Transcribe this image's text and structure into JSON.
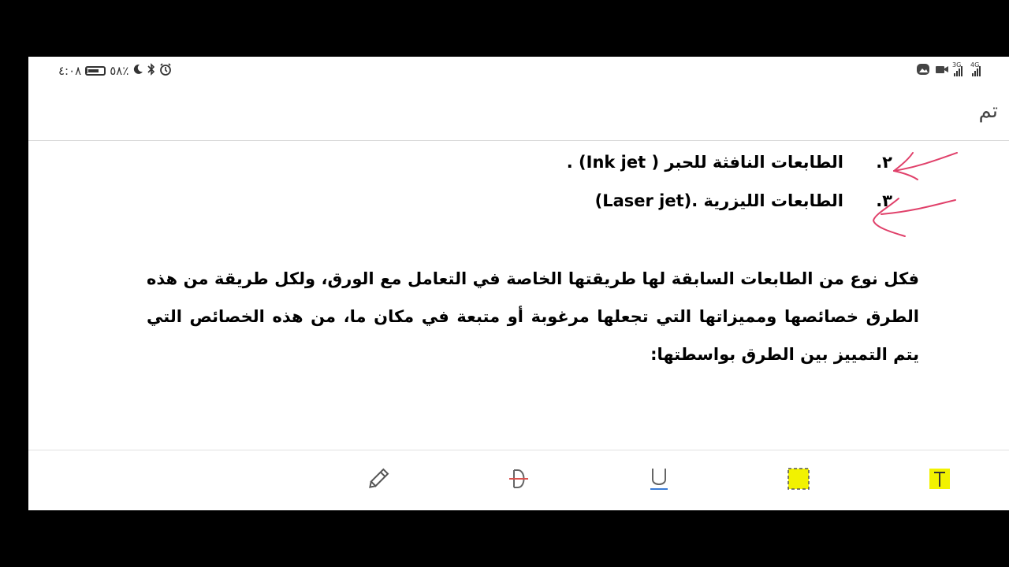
{
  "status_bar": {
    "time": "٤:٠٨",
    "battery_percent": "٥٨٪",
    "network_labels": [
      "3G",
      "4G"
    ],
    "icons": [
      "moon-icon",
      "bluetooth-icon",
      "alarm-icon",
      "battery-icon",
      "gallery-icon",
      "camera-icon",
      "signal-icon"
    ]
  },
  "header": {
    "done_label": "تم"
  },
  "document": {
    "list": [
      {
        "number": "٢.",
        "text": "الطابعات النافثة للحبر ( Ink jet)  ."
      },
      {
        "number": "٣.",
        "text": "الطابعات الليزرية .(Laser jet)"
      }
    ],
    "paragraph": "فكل نوع من الطابعات السابقة لها طريقتها الخاصة في التعامل مع الورق، ولكل طريقة من هذه الطرق خصائصها ومميزاتها التي تجعلها مرغوبة أو متبعة في مكان ما، من هذه الخصائص التي يتم التمييز بين الطرق بواسطتها:"
  },
  "annotations": {
    "arrow_color": "#e0406a",
    "count": 2
  },
  "toolbar": {
    "tools": [
      "pencil-icon",
      "strikethrough-icon",
      "underline-icon",
      "highlight-area-icon",
      "text-highlight-icon"
    ],
    "highlight_color": "#f2f200",
    "underline_color": "#3a7bd5",
    "strike_color": "#d9534f"
  }
}
